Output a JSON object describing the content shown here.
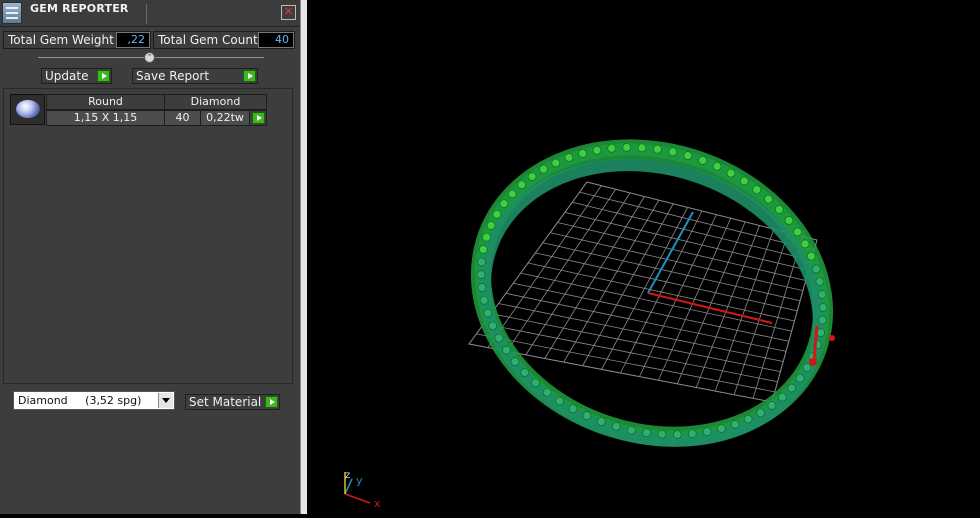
{
  "window": {
    "title": "GEM REPORTER",
    "close_glyph": "✕"
  },
  "totals": {
    "weight_label": "Total Gem Weight",
    "weight_value": ",22",
    "count_label": "Total Gem Count",
    "count_value": "40"
  },
  "actions": {
    "update_label": "Update",
    "save_label": "Save Report"
  },
  "gem_table": {
    "headers": [
      "Round",
      "Diamond"
    ],
    "rows": [
      {
        "size": "1,15 X 1,15",
        "count": "40",
        "weight": "0,22tw"
      }
    ]
  },
  "material": {
    "selected": "Diamond     (3,52 spg)",
    "set_label": "Set Material"
  },
  "viewport": {
    "axes": {
      "x": "x",
      "y": "y",
      "z": "z"
    },
    "colors": {
      "background": "#000000",
      "grid": "#9a9a9a",
      "ring": "#1fa050",
      "x_axis": "#d01818",
      "z_axis": "#1e90c0"
    }
  },
  "icons": [
    "app-icon",
    "close-icon",
    "play-icon",
    "gem-round-icon",
    "chevron-down-icon"
  ]
}
